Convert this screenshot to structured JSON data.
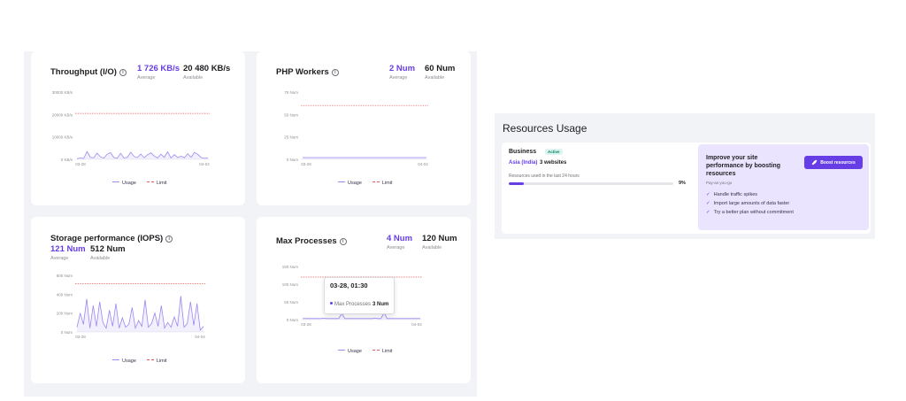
{
  "colors": {
    "accent": "#673de6",
    "usage_line": "#9d87f0",
    "limit_line": "#e45a5a",
    "panel_bg": "#f2f3f6"
  },
  "legend": {
    "usage": "Usage",
    "limit": "Limit"
  },
  "charts": {
    "throughput": {
      "title": "Throughput (I/O)",
      "avg_value": "1 726 KB/s",
      "avg_label": "Average",
      "avail_value": "20 480 KB/s",
      "avail_label": "Available",
      "y_ticks": [
        "30000 KB/s",
        "20000 KB/s",
        "10000 KB/s",
        "0 KB/s"
      ],
      "x_ticks": [
        "03-28",
        "04-04"
      ]
    },
    "php": {
      "title": "PHP Workers",
      "avg_value": "2 Num",
      "avg_label": "Average",
      "avail_value": "60 Num",
      "avail_label": "Available",
      "y_ticks": [
        "75 Num",
        "50 Num",
        "25 Num",
        "0 Num"
      ],
      "x_ticks": [
        "03-28",
        "04-04"
      ]
    },
    "storage": {
      "title": "Storage performance (IOPS)",
      "avg_value": "121 Num",
      "avg_label": "Average",
      "avail_value": "512 Num",
      "avail_label": "Available",
      "y_ticks": [
        "600 Num",
        "400 Num",
        "200 Num",
        "0 Num"
      ],
      "x_ticks": [
        "03-28",
        "04-04"
      ]
    },
    "processes": {
      "title": "Max Processes",
      "avg_value": "4 Num",
      "avg_label": "Average",
      "avail_value": "120 Num",
      "avail_label": "Available",
      "y_ticks": [
        "150 Num",
        "100 Num",
        "50 Num",
        "0 Num"
      ],
      "x_ticks": [
        "03-28",
        "04-04"
      ],
      "tooltip": {
        "title": "03-28, 01:30",
        "series": "Max Processes",
        "value": "3 Num"
      }
    }
  },
  "chart_data": [
    {
      "type": "line",
      "ylim": [
        0,
        30000
      ],
      "limit": 20480,
      "series": [
        {
          "values": [
            300,
            600,
            400,
            3500,
            900,
            700,
            2800,
            1100,
            600,
            2300,
            3000,
            800,
            500,
            2700,
            600,
            900,
            3200,
            1300,
            800,
            2400,
            700,
            2000,
            2900,
            1500,
            600,
            2300,
            900,
            3400,
            600,
            2100,
            800,
            1400,
            700,
            2500,
            900,
            3100,
            2200,
            800,
            500,
            600
          ]
        }
      ]
    },
    {
      "type": "line",
      "ylim": [
        0,
        75
      ],
      "limit": 60,
      "series": [
        {
          "values": [
            2,
            2,
            2,
            2,
            2,
            2,
            2,
            2,
            2,
            2,
            2,
            2,
            2,
            2,
            2,
            2,
            2,
            2,
            2,
            2,
            2,
            2,
            2,
            2,
            2,
            2,
            2,
            2,
            2,
            2,
            2,
            2,
            2,
            2,
            2,
            2,
            2,
            2,
            2,
            2
          ]
        }
      ]
    },
    {
      "type": "line",
      "ylim": [
        0,
        600
      ],
      "limit": 512,
      "series": [
        {
          "values": [
            50,
            200,
            80,
            350,
            40,
            280,
            60,
            320,
            100,
            40,
            230,
            60,
            300,
            40,
            150,
            50,
            80,
            260,
            40,
            120,
            60,
            340,
            50,
            90,
            200,
            60,
            280,
            40,
            100,
            50,
            160,
            60,
            380,
            50,
            90,
            320,
            70,
            300,
            20,
            60
          ]
        }
      ]
    },
    {
      "type": "line",
      "ylim": [
        0,
        150
      ],
      "limit": 120,
      "series": [
        {
          "values": [
            3,
            3,
            3,
            3,
            3,
            3,
            3,
            4,
            3,
            3,
            3,
            3,
            3,
            18,
            3,
            3,
            3,
            3,
            3,
            3,
            3,
            3,
            3,
            3,
            4,
            3,
            3,
            20,
            3,
            3,
            3,
            3,
            3,
            3,
            3,
            3,
            3,
            3,
            3,
            3
          ]
        }
      ]
    }
  ],
  "resources": {
    "title": "Resources Usage",
    "plan_name": "Business",
    "plan_badge": "Active",
    "region": "Asia (India)",
    "websites": "3 websites",
    "usage_caption": "Resources used in the last 24 hours",
    "usage_pct_text": "9%",
    "usage_fraction": 0.09
  },
  "upsell": {
    "title": "Improve your site performance by boosting resources",
    "subtitle": "Pay-as-you-go",
    "button_label": "Boost resources",
    "benefits": [
      "Handle traffic spikes",
      "Import large amounts of data faster",
      "Try a better plan without commitment"
    ]
  }
}
